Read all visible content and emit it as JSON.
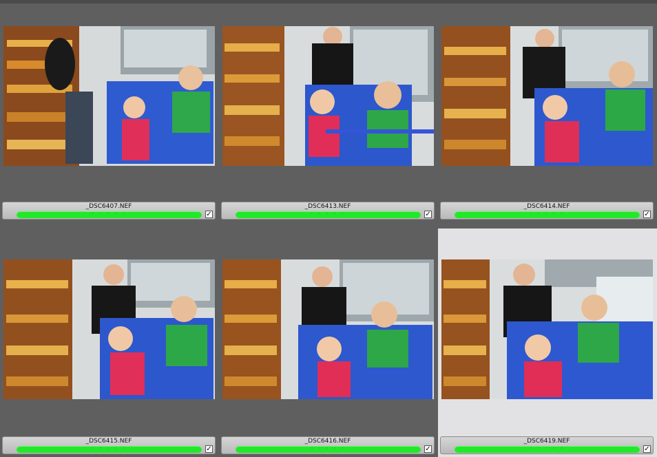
{
  "filmstrip": {
    "label_color": "#23e82a",
    "selected_background": "#e2e2e4",
    "items": [
      {
        "filename": "_DSC6407.NEF",
        "rating_dots": "· · · · ·",
        "checked": "✓",
        "selected": false
      },
      {
        "filename": "_DSC6413.NEF",
        "rating_dots": "· · · · ·",
        "checked": "✓",
        "selected": false
      },
      {
        "filename": "_DSC6414.NEF",
        "rating_dots": "· · · · ·",
        "checked": "✓",
        "selected": false
      },
      {
        "filename": "_DSC6415.NEF",
        "rating_dots": "· · · · ·",
        "checked": "✓",
        "selected": false
      },
      {
        "filename": "_DSC6416.NEF",
        "rating_dots": "· · · · ·",
        "checked": "✓",
        "selected": false
      },
      {
        "filename": "_DSC6419.NEF",
        "rating_dots": "· · · · ·",
        "checked": "✓",
        "selected": true
      }
    ]
  }
}
